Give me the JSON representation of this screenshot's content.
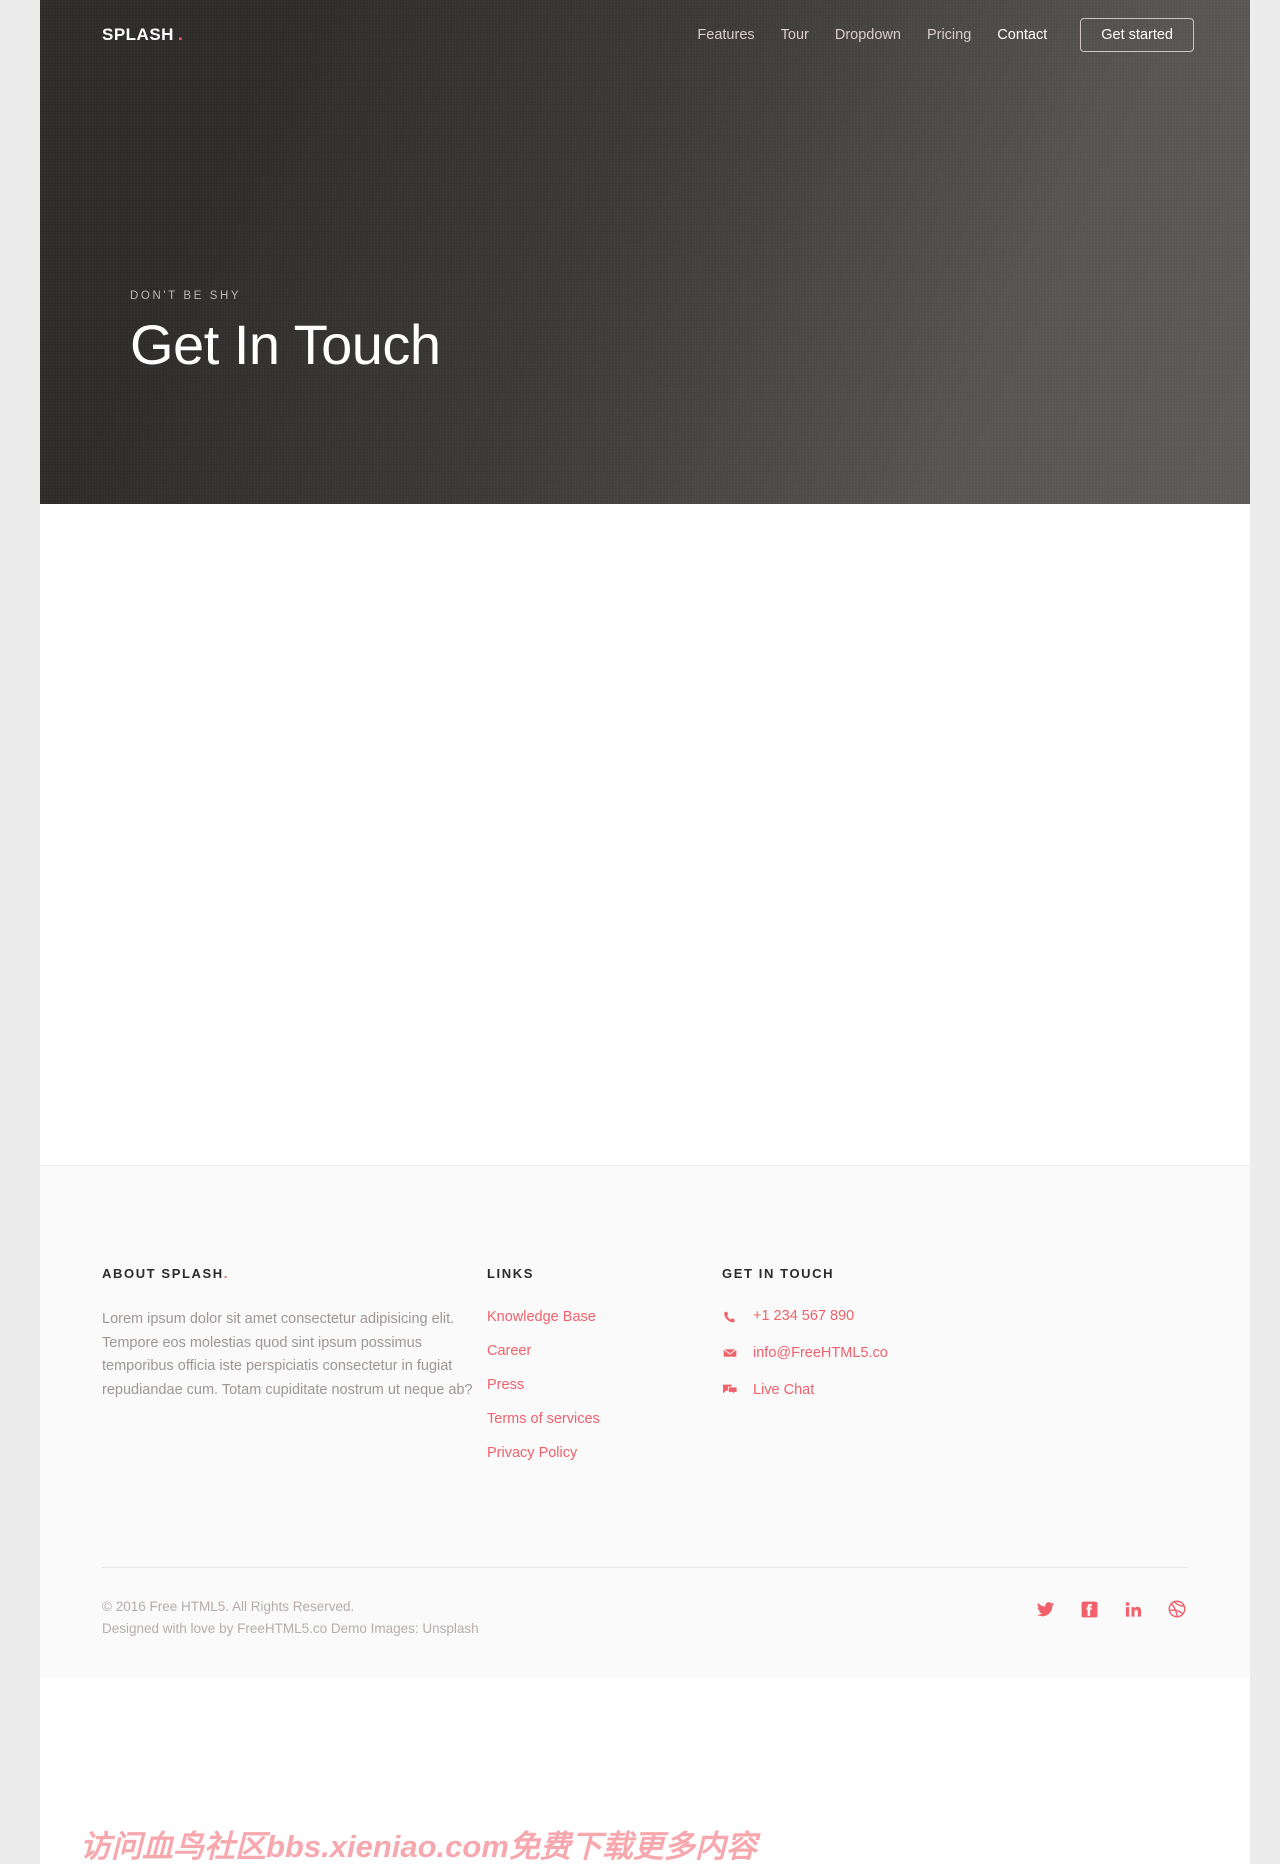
{
  "colors": {
    "accent": "#f0616b",
    "hero_dark": "#2e2b2b",
    "hero_light": "#5d5b5a",
    "page_bg": "#ececec",
    "footer_bg": "#fafafa",
    "muted_text": "#9e9695"
  },
  "nav": {
    "brand": "SPLASH",
    "brand_dot": ".",
    "items": [
      {
        "label": "Features",
        "active": false
      },
      {
        "label": "Tour",
        "active": false
      },
      {
        "label": "Dropdown",
        "active": false
      },
      {
        "label": "Pricing",
        "active": false
      },
      {
        "label": "Contact",
        "active": true
      }
    ],
    "cta_label": "Get started"
  },
  "hero": {
    "eyebrow": "DON'T BE SHY",
    "title": "Get In Touch"
  },
  "footer": {
    "about": {
      "heading": "ABOUT SPLASH",
      "heading_dot": ".",
      "text": "Lorem ipsum dolor sit amet consectetur adipisicing elit. Tempore eos molestias quod sint ipsum possimus temporibus officia iste perspiciatis consectetur in fugiat repudiandae cum. Totam cupiditate nostrum ut neque ab?"
    },
    "links": {
      "heading": "LINKS",
      "items": [
        "Knowledge Base",
        "Career",
        "Press",
        "Terms of services",
        "Privacy Policy"
      ]
    },
    "touch": {
      "heading": "GET IN TOUCH",
      "items": [
        {
          "icon": "phone-icon",
          "label": "+1 234 567 890"
        },
        {
          "icon": "envelope-icon",
          "label": "info@FreeHTML5.co"
        },
        {
          "icon": "chat-icon",
          "label": "Live Chat"
        }
      ]
    },
    "bottom": {
      "copyright_line1": "© 2016 Free HTML5. All Rights Reserved.",
      "copyright_line2": "Designed with love by FreeHTML5.co Demo Images: Unsplash",
      "social": [
        {
          "icon": "twitter-icon",
          "label": "Twitter"
        },
        {
          "icon": "facebook-icon",
          "label": "Facebook"
        },
        {
          "icon": "linkedin-icon",
          "label": "LinkedIn"
        },
        {
          "icon": "dribbble-icon",
          "label": "Dribbble"
        }
      ]
    }
  },
  "watermark": {
    "text": "访问血鸟社区bbs.xieniao.com免费下载更多内容"
  }
}
